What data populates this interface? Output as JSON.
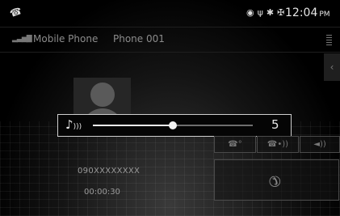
{
  "status_bar": {
    "call_icon": "phone-icon",
    "icons": [
      "navigation-icon",
      "usb-icon",
      "bluetooth-icon",
      "wifi-icon"
    ],
    "time": "12:04",
    "ampm": "PM"
  },
  "header": {
    "signal_icon": "signal-strength-icon",
    "device": "Mobile Phone",
    "phone_name": "Phone 001",
    "menu_icon": "menu-icon"
  },
  "volume": {
    "icon": "ringtone-volume-icon",
    "level": 5,
    "max": 10,
    "display": "5"
  },
  "call": {
    "number": "090XXXXXXXX",
    "duration": "00:00:30"
  },
  "controls": {
    "hold_icon": "call-hold-icon",
    "transfer_icon": "handset-transfer-icon",
    "speaker_icon": "speaker-icon",
    "end_call_icon": "end-call-icon"
  },
  "colors": {
    "background": "#000000",
    "accent": "#cfcfcf"
  }
}
